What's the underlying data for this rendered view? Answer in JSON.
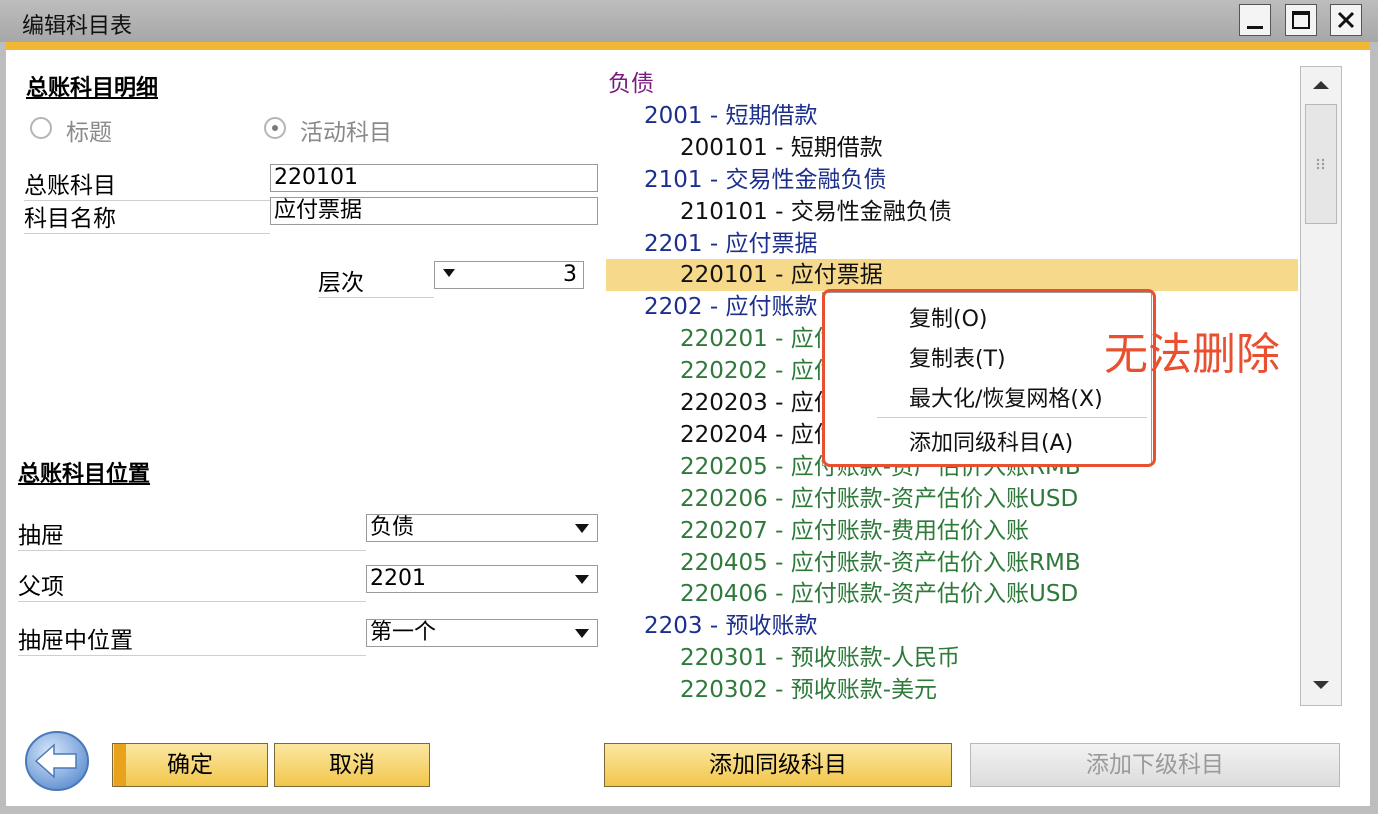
{
  "window": {
    "title": "编辑科目表"
  },
  "detail": {
    "section_title": "总账科目明细",
    "radio_title_label": "标题",
    "radio_active_label": "活动科目",
    "account_label": "总账科目",
    "account_value": "220101",
    "name_label": "科目名称",
    "name_value": "应付票据",
    "level_label": "层次",
    "level_value": "3"
  },
  "position": {
    "section_title": "总账科目位置",
    "drawer_label": "抽屉",
    "drawer_value": "负债",
    "parent_label": "父项",
    "parent_value": "2201",
    "drawer_pos_label": "抽屉中位置",
    "drawer_pos_value": "第一个"
  },
  "tree": {
    "rows": [
      {
        "text": "负债",
        "level": 0
      },
      {
        "text": "2001 - 短期借款",
        "level": 1
      },
      {
        "text": "200101 - 短期借款",
        "level": 2
      },
      {
        "text": "2101 - 交易性金融负债",
        "level": 1
      },
      {
        "text": "210101 - 交易性金融负债",
        "level": 2
      },
      {
        "text": "2201 - 应付票据",
        "level": 1
      },
      {
        "text": "220101 - 应付票据",
        "level": 2,
        "selected": true
      },
      {
        "text": "2202 - 应付账款",
        "level": 1
      },
      {
        "text": "220201 - 应付",
        "level": 2
      },
      {
        "text": "220202 - 应付",
        "level": 2
      },
      {
        "text": "220203 - 应付",
        "level": 2
      },
      {
        "text": "220204 - 应付",
        "level": 2
      },
      {
        "text": "220205 - 应付账款-资产估价入账RMB",
        "level": 2
      },
      {
        "text": "220206 - 应付账款-资产估价入账USD",
        "level": 2
      },
      {
        "text": "220207 - 应付账款-费用估价入账",
        "level": 2
      },
      {
        "text": "220405 - 应付账款-资产估价入账RMB",
        "level": 2
      },
      {
        "text": "220406 - 应付账款-资产估价入账USD",
        "level": 2
      },
      {
        "text": "2203 - 预收账款",
        "level": 1
      },
      {
        "text": "220301 - 预收账款-人民币",
        "level": 2
      },
      {
        "text": "220302 - 预收账款-美元",
        "level": 2
      }
    ]
  },
  "context_menu": {
    "items": [
      "复制(O)",
      "复制表(T)",
      "最大化/恢复网格(X)",
      "添加同级科目(A)"
    ]
  },
  "annotation": {
    "text": "无法删除"
  },
  "buttons": {
    "ok": "确定",
    "cancel": "取消",
    "add_sibling": "添加同级科目",
    "add_child": "添加下级科目"
  },
  "colors": {
    "accent_gold": "#f1b733",
    "selection": "#f7d98c",
    "annotation_red": "#e8502f",
    "level0": "#7a1a7f",
    "level1": "#1c2f8c",
    "level2_black": "#111111",
    "level2_green": "#2e7a3a"
  }
}
